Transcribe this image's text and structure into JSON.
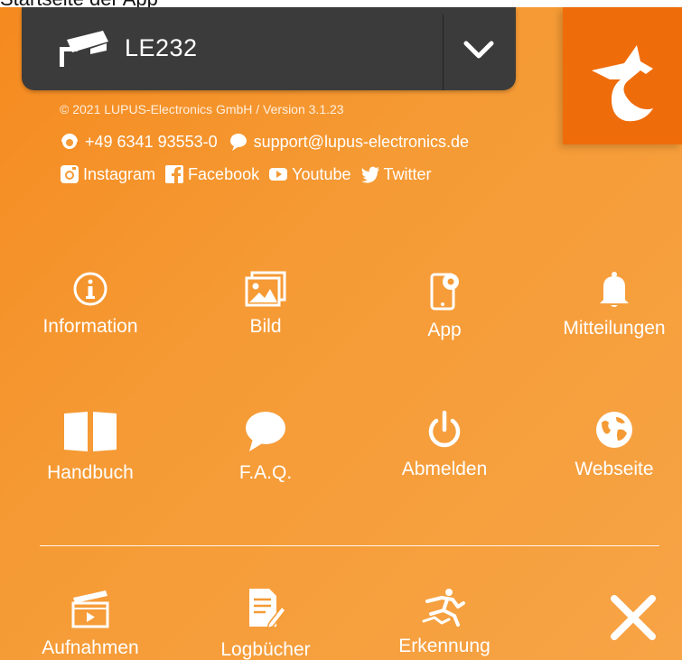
{
  "top_partial_text": "Startseite der App",
  "camera": {
    "name": "LE232",
    "icon": "camera-icon",
    "dropdown_icon": "chevron-down-icon"
  },
  "logo": {
    "icon": "lupus-wolf-logo"
  },
  "footer_info": {
    "copyright": "© 2021 LUPUS-Electronics GmbH / Version 3.1.23",
    "phone": "+49 6341 93553-0",
    "email": "support@lupus-electronics.de"
  },
  "social": {
    "instagram": "Instagram",
    "facebook": "Facebook",
    "youtube": "Youtube",
    "twitter": "Twitter"
  },
  "menu": {
    "information": "Information",
    "bild": "Bild",
    "app": "App",
    "mitteilungen": "Mitteilungen",
    "handbuch": "Handbuch",
    "faq": "F.A.Q.",
    "abmelden": "Abmelden",
    "webseite": "Webseite",
    "aufnahmen": "Aufnahmen",
    "logbuecher": "Logbücher",
    "erkennung": "Erkennung"
  },
  "close_icon": "close-icon",
  "colors": {
    "background": "#f58a1f",
    "camera_bar": "#3b3b3b",
    "logo_tile": "#ef6c0b",
    "text": "#ffffff"
  }
}
